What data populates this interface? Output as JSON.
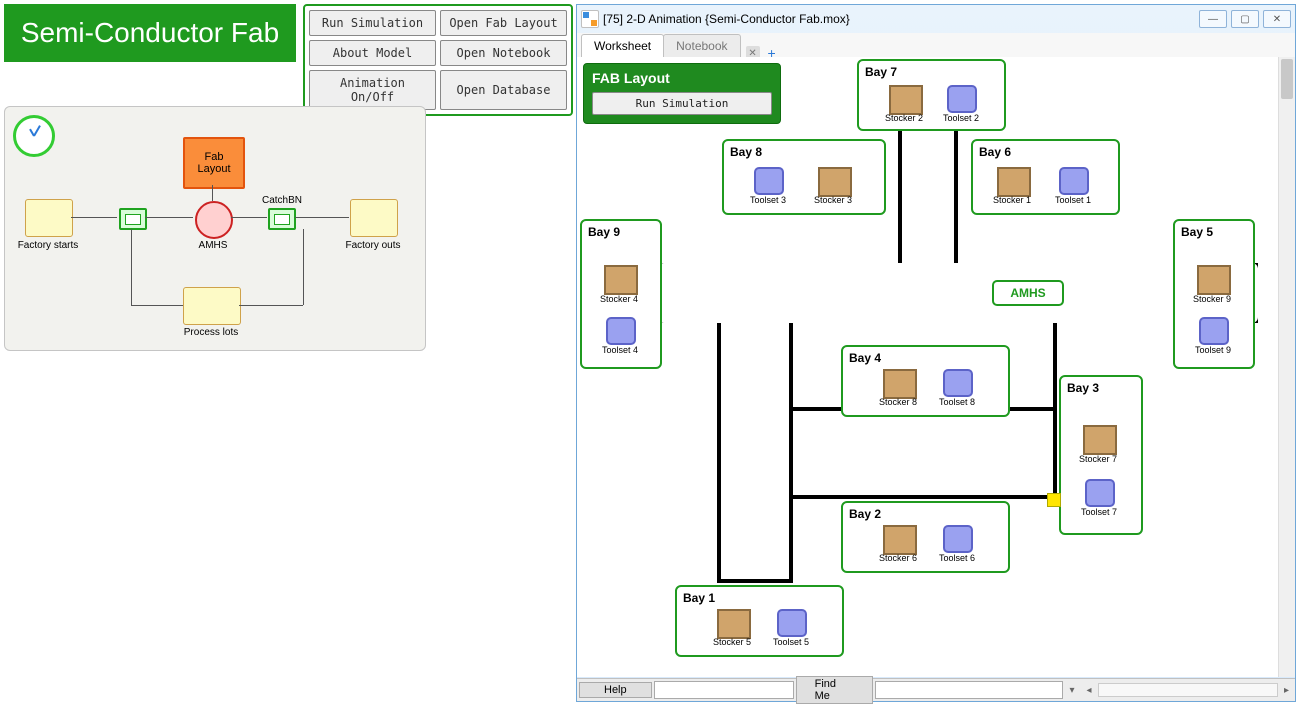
{
  "title_banner": "Semi-Conductor Fab",
  "buttons": {
    "run_sim": "Run Simulation",
    "open_fab": "Open Fab Layout",
    "about": "About Model",
    "open_nb": "Open Notebook",
    "anim": "Animation On/Off",
    "open_db": "Open Database"
  },
  "model": {
    "fab_layout": "Fab\nLayout",
    "factory_starts": "Factory starts",
    "amhs": "AMHS",
    "catchbn": "CatchBN",
    "factory_outs": "Factory outs",
    "process_lots": "Process lots"
  },
  "window": {
    "title": "[75] 2-D Animation {Semi-Conductor Fab.mox}",
    "tabs": {
      "worksheet": "Worksheet",
      "notebook": "Notebook"
    },
    "fab_panel": {
      "title": "FAB Layout",
      "run": "Run Simulation"
    },
    "amhs": "AMHS",
    "bays": {
      "b1": "Bay 1",
      "b2": "Bay 2",
      "b3": "Bay 3",
      "b4": "Bay 4",
      "b5": "Bay 5",
      "b6": "Bay 6",
      "b7": "Bay 7",
      "b8": "Bay 8",
      "b9": "Bay 9"
    },
    "items": {
      "stocker1": "Stocker 1",
      "stocker2": "Stocker 2",
      "stocker3": "Stocker 3",
      "stocker4": "Stocker 4",
      "stocker5": "Stocker 5",
      "stocker6": "Stocker 6",
      "stocker7": "Stocker 7",
      "stocker8": "Stocker 8",
      "stocker9": "Stocker 9",
      "toolset1": "Toolset 1",
      "toolset2": "Toolset 2",
      "toolset3": "Toolset 3",
      "toolset4": "Toolset 4",
      "toolset5": "Toolset 5",
      "toolset6": "Toolset 6",
      "toolset7": "Toolset 7",
      "toolset8": "Toolset 8"
    },
    "status": {
      "help": "Help",
      "find": "Find Me",
      "search_ph": ""
    }
  }
}
